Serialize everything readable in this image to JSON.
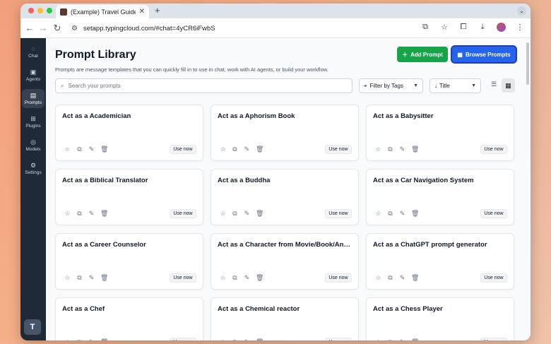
{
  "browser": {
    "tab_title": "(Example) Travel Guide - Typ",
    "url": "setapp.typingcloud.com/#chat=4yCR6iFwbS"
  },
  "sidebar": {
    "items": [
      {
        "label": "Chat",
        "icon": "chat-bubble-icon"
      },
      {
        "label": "Agents",
        "icon": "agents-icon"
      },
      {
        "label": "Prompts",
        "icon": "prompts-icon",
        "active": true
      },
      {
        "label": "Plugins",
        "icon": "plugins-icon"
      },
      {
        "label": "Models",
        "icon": "models-icon"
      },
      {
        "label": "Settings",
        "icon": "settings-icon"
      }
    ],
    "avatar_initial": "T"
  },
  "header": {
    "title": "Prompt Library",
    "subtitle": "Prompts are message templates that you can quickly fill in to use in chat, work with AI agents, or build your workflow.",
    "add_label": "Add Prompt",
    "browse_label": "Browse Prompts"
  },
  "toolbar": {
    "search_placeholder": "Search your prompts",
    "filter_label": "Filter by Tags",
    "sort_label": "Title"
  },
  "cards": [
    {
      "title": "Act as a Academician",
      "editable": false
    },
    {
      "title": "Act as a Aphorism Book",
      "editable": true
    },
    {
      "title": "Act as a Babysitter",
      "editable": true
    },
    {
      "title": "Act as a Biblical Translator",
      "editable": false
    },
    {
      "title": "Act as a Buddha",
      "editable": true
    },
    {
      "title": "Act as a Car Navigation System",
      "editable": true
    },
    {
      "title": "Act as a Career Counselor",
      "editable": false
    },
    {
      "title": "Act as a Character from Movie/Book/Anything",
      "editable": true
    },
    {
      "title": "Act as a ChatGPT prompt generator",
      "editable": true
    },
    {
      "title": "Act as a Chef",
      "editable": false
    },
    {
      "title": "Act as a Chemical reactor",
      "editable": true
    },
    {
      "title": "Act as a Chess Player",
      "editable": true
    }
  ],
  "use_now_label": "Use now",
  "colors": {
    "accent_green": "#16a34a",
    "accent_blue": "#2563eb",
    "sidebar": "#1f2937"
  }
}
